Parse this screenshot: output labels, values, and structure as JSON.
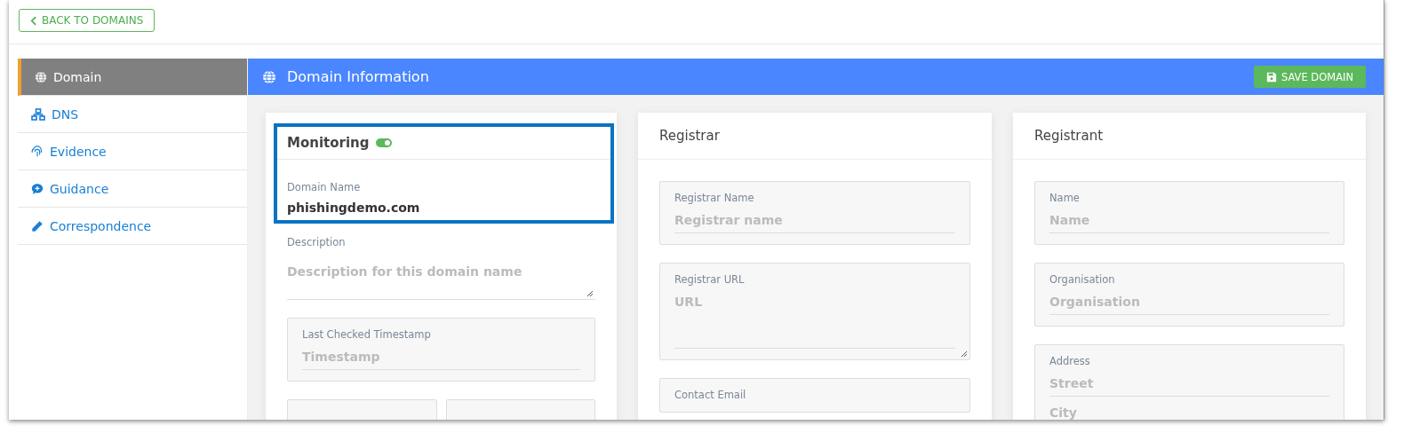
{
  "back_button": {
    "label": "BACK TO DOMAINS"
  },
  "sidebar": {
    "items": [
      {
        "label": "Domain",
        "kind": "globe",
        "selected": true
      },
      {
        "label": "DNS",
        "kind": "network",
        "selected": false
      },
      {
        "label": "Evidence",
        "kind": "fingerprint",
        "selected": false
      },
      {
        "label": "Guidance",
        "kind": "comment",
        "selected": false
      },
      {
        "label": "Correspondence",
        "kind": "pencil",
        "selected": false
      }
    ]
  },
  "header": {
    "title": "Domain Information",
    "save_button": "SAVE DOMAIN"
  },
  "domain_card": {
    "title": "Monitoring",
    "monitoring_on": true,
    "highlighted": true,
    "domain_name": {
      "label": "Domain Name",
      "value": "phishingdemo.com"
    },
    "description": {
      "label": "Description",
      "placeholder": "Description for this domain name"
    },
    "last_checked": {
      "label": "Last Checked Timestamp",
      "placeholder": "Timestamp"
    }
  },
  "registrar": {
    "title": "Registrar",
    "fields": [
      {
        "kind": "input",
        "label": "Registrar Name",
        "placeholders": [
          "Registrar name"
        ]
      },
      {
        "kind": "textarea",
        "label": "Registrar URL",
        "placeholders": [
          "URL"
        ]
      },
      {
        "kind": "input",
        "label": "Contact Email"
      }
    ]
  },
  "registrant": {
    "title": "Registrant",
    "fields": [
      {
        "kind": "input",
        "label": "Name",
        "placeholders": [
          "Name"
        ]
      },
      {
        "kind": "input",
        "label": "Organisation",
        "placeholders": [
          "Organisation"
        ]
      },
      {
        "kind": "input",
        "label": "Address",
        "placeholders": [
          "Street",
          "City"
        ]
      }
    ]
  }
}
